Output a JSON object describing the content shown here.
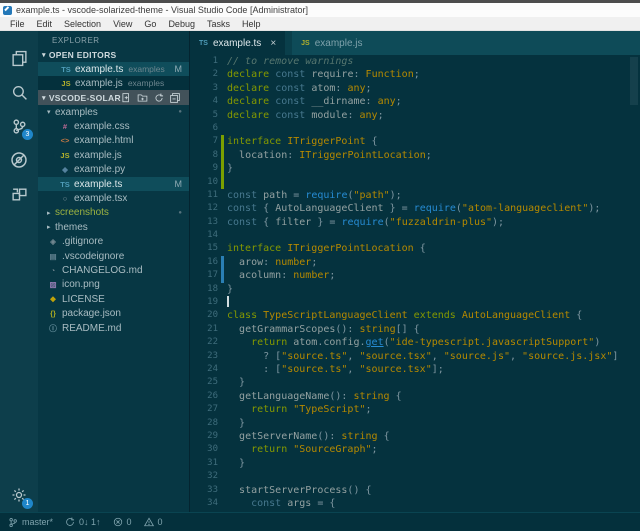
{
  "window": {
    "title": "example.ts - vscode-solarized-theme - Visual Studio Code [Administrator]"
  },
  "menu": {
    "items": [
      "File",
      "Edit",
      "Selection",
      "View",
      "Go",
      "Debug",
      "Tasks",
      "Help"
    ]
  },
  "activity_bar": {
    "items": [
      {
        "name": "explorer",
        "badge": null
      },
      {
        "name": "search",
        "badge": null
      },
      {
        "name": "source-control",
        "badge": "3"
      },
      {
        "name": "debug",
        "badge": null
      },
      {
        "name": "extensions",
        "badge": null
      }
    ],
    "bottom_items": [
      {
        "name": "settings",
        "badge": "1"
      }
    ]
  },
  "sidebar": {
    "title": "EXPLORER",
    "open_editors": {
      "label": "OPEN EDITORS",
      "items": [
        {
          "icon": "ts",
          "label": "example.ts",
          "description": "examples",
          "badge": "M",
          "selected": true
        },
        {
          "icon": "js",
          "label": "example.js",
          "description": "examples",
          "badge": null,
          "selected": false
        }
      ]
    },
    "folder_section": {
      "label": "VSCODE-SOLARIZED...",
      "actions": [
        "new-file",
        "new-folder",
        "refresh",
        "collapse-all"
      ],
      "tree": [
        {
          "label": "examples",
          "icon": null,
          "arrow": "expanded",
          "indent": 1,
          "badge": "dot"
        },
        {
          "label": "example.css",
          "icon": "css",
          "indent": 2
        },
        {
          "label": "example.html",
          "icon": "html",
          "indent": 2
        },
        {
          "label": "example.js",
          "icon": "js",
          "indent": 2
        },
        {
          "label": "example.py",
          "icon": "py",
          "indent": 2
        },
        {
          "label": "example.ts",
          "icon": "ts",
          "indent": 2,
          "selected": true,
          "badge": "M"
        },
        {
          "label": "example.tsx",
          "icon": "tsx",
          "indent": 2
        },
        {
          "label": "screenshots",
          "icon": null,
          "arrow": "collapsed",
          "indent": 1,
          "badge": "dot",
          "git_color": "green"
        },
        {
          "label": "themes",
          "icon": null,
          "arrow": "collapsed",
          "indent": 1
        },
        {
          "label": ".gitignore",
          "icon": "gitignore",
          "indent": 1
        },
        {
          "label": ".vscodeignore",
          "icon": "vscodeignore",
          "indent": 1
        },
        {
          "label": "CHANGELOG.md",
          "icon": "changelog",
          "indent": 1
        },
        {
          "label": "icon.png",
          "icon": "image",
          "indent": 1
        },
        {
          "label": "LICENSE",
          "icon": "license",
          "indent": 1
        },
        {
          "label": "package.json",
          "icon": "json",
          "indent": 1
        },
        {
          "label": "README.md",
          "icon": "readme",
          "indent": 1
        }
      ]
    }
  },
  "tabs": [
    {
      "label": "example.ts",
      "icon": "ts",
      "active": true,
      "close_glyph": "×"
    },
    {
      "label": "example.js",
      "icon": "js",
      "active": false,
      "close_glyph": null
    }
  ],
  "editor": {
    "cursor_line": 19,
    "lines": [
      {
        "n": 1,
        "git": null,
        "tokens": [
          [
            "cm",
            "// to remove warnings"
          ]
        ]
      },
      {
        "n": 2,
        "git": null,
        "tokens": [
          [
            "kw",
            "declare"
          ],
          [
            "pl",
            " "
          ],
          [
            "st",
            "const"
          ],
          [
            "pl",
            " "
          ],
          [
            "id",
            "require"
          ],
          [
            "pn",
            ":"
          ],
          [
            "pl",
            " "
          ],
          [
            "ty",
            "Function"
          ],
          [
            "pn",
            ";"
          ]
        ]
      },
      {
        "n": 3,
        "git": null,
        "tokens": [
          [
            "kw",
            "declare"
          ],
          [
            "pl",
            " "
          ],
          [
            "st",
            "const"
          ],
          [
            "pl",
            " "
          ],
          [
            "id",
            "atom"
          ],
          [
            "pn",
            ":"
          ],
          [
            "pl",
            " "
          ],
          [
            "ty",
            "any"
          ],
          [
            "pn",
            ";"
          ]
        ]
      },
      {
        "n": 4,
        "git": null,
        "tokens": [
          [
            "kw",
            "declare"
          ],
          [
            "pl",
            " "
          ],
          [
            "st",
            "const"
          ],
          [
            "pl",
            " "
          ],
          [
            "id",
            "__dirname"
          ],
          [
            "pn",
            ":"
          ],
          [
            "pl",
            " "
          ],
          [
            "ty",
            "any"
          ],
          [
            "pn",
            ";"
          ]
        ]
      },
      {
        "n": 5,
        "git": null,
        "tokens": [
          [
            "kw",
            "declare"
          ],
          [
            "pl",
            " "
          ],
          [
            "st",
            "const"
          ],
          [
            "pl",
            " "
          ],
          [
            "id",
            "module"
          ],
          [
            "pn",
            ":"
          ],
          [
            "pl",
            " "
          ],
          [
            "ty",
            "any"
          ],
          [
            "pn",
            ";"
          ]
        ]
      },
      {
        "n": 6,
        "git": null,
        "tokens": []
      },
      {
        "n": 7,
        "git": "a",
        "tokens": [
          [
            "kw",
            "interface"
          ],
          [
            "pl",
            " "
          ],
          [
            "ty",
            "ITriggerPoint"
          ],
          [
            "pl",
            " "
          ],
          [
            "pn",
            "{"
          ]
        ]
      },
      {
        "n": 8,
        "git": "a",
        "tokens": [
          [
            "pl",
            "  "
          ],
          [
            "id",
            "location"
          ],
          [
            "pn",
            ":"
          ],
          [
            "pl",
            " "
          ],
          [
            "ty",
            "ITriggerPointLocation"
          ],
          [
            "pn",
            ";"
          ]
        ]
      },
      {
        "n": 9,
        "git": "a",
        "tokens": [
          [
            "pn",
            "}"
          ]
        ]
      },
      {
        "n": 10,
        "git": "a",
        "tokens": []
      },
      {
        "n": 11,
        "git": null,
        "tokens": [
          [
            "st",
            "const"
          ],
          [
            "pl",
            " "
          ],
          [
            "id",
            "path"
          ],
          [
            "pl",
            " "
          ],
          [
            "pn",
            "="
          ],
          [
            "pl",
            " "
          ],
          [
            "fn",
            "require"
          ],
          [
            "pn",
            "("
          ],
          [
            "str",
            "\"path\""
          ],
          [
            "pn",
            ");"
          ]
        ]
      },
      {
        "n": 12,
        "git": null,
        "tokens": [
          [
            "st",
            "const"
          ],
          [
            "pl",
            " "
          ],
          [
            "pn",
            "{"
          ],
          [
            "pl",
            " "
          ],
          [
            "id",
            "AutoLanguageClient"
          ],
          [
            "pl",
            " "
          ],
          [
            "pn",
            "}"
          ],
          [
            "pl",
            " "
          ],
          [
            "pn",
            "="
          ],
          [
            "pl",
            " "
          ],
          [
            "fn",
            "require"
          ],
          [
            "pn",
            "("
          ],
          [
            "str",
            "\"atom-languageclient\""
          ],
          [
            "pn",
            ");"
          ]
        ]
      },
      {
        "n": 13,
        "git": null,
        "tokens": [
          [
            "st",
            "const"
          ],
          [
            "pl",
            " "
          ],
          [
            "pn",
            "{"
          ],
          [
            "pl",
            " "
          ],
          [
            "id",
            "filter"
          ],
          [
            "pl",
            " "
          ],
          [
            "pn",
            "}"
          ],
          [
            "pl",
            " "
          ],
          [
            "pn",
            "="
          ],
          [
            "pl",
            " "
          ],
          [
            "fn",
            "require"
          ],
          [
            "pn",
            "("
          ],
          [
            "str",
            "\"fuzzaldrin-plus\""
          ],
          [
            "pn",
            ");"
          ]
        ]
      },
      {
        "n": 14,
        "git": null,
        "tokens": []
      },
      {
        "n": 15,
        "git": null,
        "tokens": [
          [
            "kw",
            "interface"
          ],
          [
            "pl",
            " "
          ],
          [
            "ty",
            "ITriggerPointLocation"
          ],
          [
            "pl",
            " "
          ],
          [
            "pn",
            "{"
          ]
        ]
      },
      {
        "n": 16,
        "git": "m",
        "tokens": [
          [
            "pl",
            "  "
          ],
          [
            "id",
            "arow"
          ],
          [
            "pn",
            ":"
          ],
          [
            "pl",
            " "
          ],
          [
            "ty",
            "number"
          ],
          [
            "pn",
            ";"
          ]
        ]
      },
      {
        "n": 17,
        "git": "m",
        "tokens": [
          [
            "pl",
            "  "
          ],
          [
            "id",
            "acolumn"
          ],
          [
            "pn",
            ":"
          ],
          [
            "pl",
            " "
          ],
          [
            "ty",
            "number"
          ],
          [
            "pn",
            ";"
          ]
        ]
      },
      {
        "n": 18,
        "git": null,
        "tokens": [
          [
            "pn",
            "}"
          ]
        ]
      },
      {
        "n": 19,
        "git": null,
        "tokens": []
      },
      {
        "n": 20,
        "git": null,
        "tokens": [
          [
            "kw",
            "class"
          ],
          [
            "pl",
            " "
          ],
          [
            "ty",
            "TypeScriptLanguageClient"
          ],
          [
            "pl",
            " "
          ],
          [
            "kw",
            "extends"
          ],
          [
            "pl",
            " "
          ],
          [
            "ty",
            "AutoLanguageClient"
          ],
          [
            "pl",
            " "
          ],
          [
            "pn",
            "{"
          ]
        ]
      },
      {
        "n": 21,
        "git": null,
        "tokens": [
          [
            "pl",
            "  "
          ],
          [
            "id",
            "getGrammarScopes"
          ],
          [
            "pn",
            "():"
          ],
          [
            "pl",
            " "
          ],
          [
            "ty",
            "string"
          ],
          [
            "pn",
            "[] {"
          ]
        ]
      },
      {
        "n": 22,
        "git": null,
        "tokens": [
          [
            "pl",
            "    "
          ],
          [
            "kw",
            "return"
          ],
          [
            "pl",
            " "
          ],
          [
            "id",
            "atom"
          ],
          [
            "pn",
            "."
          ],
          [
            "id",
            "config"
          ],
          [
            "pn",
            "."
          ],
          [
            "u",
            "get"
          ],
          [
            "pn",
            "("
          ],
          [
            "str",
            "\"ide-typescript.javascriptSupport\""
          ],
          [
            "pn",
            ")"
          ]
        ]
      },
      {
        "n": 23,
        "git": null,
        "tokens": [
          [
            "pl",
            "      "
          ],
          [
            "pn",
            "? ["
          ],
          [
            "str",
            "\"source.ts\""
          ],
          [
            "pn",
            ", "
          ],
          [
            "str",
            "\"source.tsx\""
          ],
          [
            "pn",
            ", "
          ],
          [
            "str",
            "\"source.js\""
          ],
          [
            "pn",
            ", "
          ],
          [
            "str",
            "\"source.js.jsx\""
          ],
          [
            "pn",
            "]"
          ]
        ]
      },
      {
        "n": 24,
        "git": null,
        "tokens": [
          [
            "pl",
            "      "
          ],
          [
            "pn",
            ": ["
          ],
          [
            "str",
            "\"source.ts\""
          ],
          [
            "pn",
            ", "
          ],
          [
            "str",
            "\"source.tsx\""
          ],
          [
            "pn",
            "];"
          ]
        ]
      },
      {
        "n": 25,
        "git": null,
        "tokens": [
          [
            "pl",
            "  "
          ],
          [
            "pn",
            "}"
          ]
        ]
      },
      {
        "n": 26,
        "git": null,
        "tokens": [
          [
            "pl",
            "  "
          ],
          [
            "id",
            "getLanguageName"
          ],
          [
            "pn",
            "():"
          ],
          [
            "pl",
            " "
          ],
          [
            "ty",
            "string"
          ],
          [
            "pl",
            " "
          ],
          [
            "pn",
            "{"
          ]
        ]
      },
      {
        "n": 27,
        "git": null,
        "tokens": [
          [
            "pl",
            "    "
          ],
          [
            "kw",
            "return"
          ],
          [
            "pl",
            " "
          ],
          [
            "str",
            "\"TypeScript\""
          ],
          [
            "pn",
            ";"
          ]
        ]
      },
      {
        "n": 28,
        "git": null,
        "tokens": [
          [
            "pl",
            "  "
          ],
          [
            "pn",
            "}"
          ]
        ]
      },
      {
        "n": 29,
        "git": null,
        "tokens": [
          [
            "pl",
            "  "
          ],
          [
            "id",
            "getServerName"
          ],
          [
            "pn",
            "():"
          ],
          [
            "pl",
            " "
          ],
          [
            "ty",
            "string"
          ],
          [
            "pl",
            " "
          ],
          [
            "pn",
            "{"
          ]
        ]
      },
      {
        "n": 30,
        "git": null,
        "tokens": [
          [
            "pl",
            "    "
          ],
          [
            "kw",
            "return"
          ],
          [
            "pl",
            " "
          ],
          [
            "str",
            "\"SourceGraph\""
          ],
          [
            "pn",
            ";"
          ]
        ]
      },
      {
        "n": 31,
        "git": null,
        "tokens": [
          [
            "pl",
            "  "
          ],
          [
            "pn",
            "}"
          ]
        ]
      },
      {
        "n": 32,
        "git": null,
        "tokens": []
      },
      {
        "n": 33,
        "git": null,
        "tokens": [
          [
            "pl",
            "  "
          ],
          [
            "id",
            "startServerProcess"
          ],
          [
            "pn",
            "() {"
          ]
        ]
      },
      {
        "n": 34,
        "git": null,
        "tokens": [
          [
            "pl",
            "    "
          ],
          [
            "st",
            "const"
          ],
          [
            "pl",
            " "
          ],
          [
            "id",
            "args"
          ],
          [
            "pl",
            " "
          ],
          [
            "pn",
            "= {"
          ]
        ]
      }
    ]
  },
  "status_bar": {
    "items": [
      {
        "name": "git-branch",
        "icon": "branch",
        "label": "master*"
      },
      {
        "name": "sync-status",
        "icon": "sync",
        "label": "0↓ 1↑"
      },
      {
        "name": "errors",
        "icon": "error",
        "label": "0"
      },
      {
        "name": "warnings",
        "icon": "warning",
        "label": "0"
      }
    ]
  },
  "colors": {
    "editor_bg": "#05323e",
    "sidebar_bg": "#073744",
    "activity_bar_bg": "#0d3e4b",
    "tab_bar_bg": "#0e4b58",
    "selection_bg": "#0f4d5b",
    "badge_blue": "#1f86c9",
    "git_added": "#7ba000",
    "git_modified": "#2a7fb4",
    "syntax_keyword": "#859900",
    "syntax_type_string": "#b58900",
    "syntax_function": "#268bd2",
    "syntax_comment": "#56766f"
  }
}
